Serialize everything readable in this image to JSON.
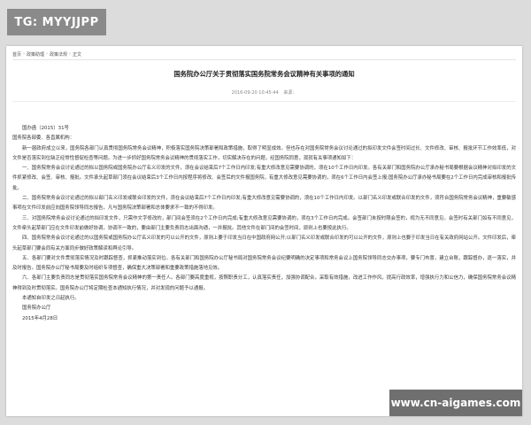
{
  "watermarks": {
    "top": "TG: MYYJJPP",
    "bottom": "www.cn-aigames.com"
  },
  "breadcrumb": {
    "items": [
      "首页",
      "政策助理",
      "政策法规",
      "正文"
    ],
    "separator": "›"
  },
  "article": {
    "title": "国务院办公厅关于贯彻落实国务院常务会议精神有关事项的通知",
    "date": "2016-09-20 10:45:44",
    "source": "来源："
  },
  "doc": {
    "number": "国办函〔2015〕31号",
    "salutation": "国务院各部委、各直属机构：",
    "paragraphs": [
      "新一届政府成立以来，国务院各部门认真贯彻国务院常务会议精神，积极落实国务院决策部署和政策措施，取得了明显成效。但也存在对国务院常务会议讨论通过的拟印发文件会签时间过长、文件修改、审核、报批环节工作效率低，对文件是否落实到位缺乏经常性督促检查等问题。为进一步抓好国务院常务会议精神的贯彻落实工作，切实解决存在的问题，经国务院同意，现就有关事项通知如下：",
      "一、国务院常务会议讨论通过的拟以国务院或国务院办公厅名义印发的文件，须在会议结束后7个工作日内印发;有重大修改意见需要协调的，须在10个工作日内印发。各有关部门和国务院办公厅承办秘书局要根据会议精神对拟印发的文件抓紧修改、会签、审核、报批。文件承头起草部门须在会议结束后3个工作日内按程序将修改、会签后的文件报国务院，有重大修改意见需要协调的，须在6个工作日内会签上报;国务院办公厅承办秘书局要在2个工作日内完成审核和报批传批。",
      "二、国务院常务会议讨论通过的拟以部门名义印发或联合印发的文件，须在会议结束后7个工作日内印发;有重大修改意见需要协调的，须在10个工作日内印发。以部门名义印发或联合印发的文件，须符合国务院常务会议精神，重要敏感事项在文件印发前应向国务院领导同志报告，凡与国务院决策部署和总体要求不一致的不得印发。",
      "三、对国务院常务会议讨论通过的拟印发文件，只需作文字修改的，部门间会签须在2个工作日内完成;有重大修改意见需要协调的，须在3个工作日内完成。会签部门未按时限会签的，视为无不同意见。会签时有关部门如有不同意见，文件牵头起草部门应在文件印发前做好协调，协调不一致的，要由部门主要负责同志出面沟通，一并报批。其他文件在部门间的会签时间，原则上也要按此执行。",
      "四、国务院常务会议讨论通过的以国务院或国务院办公厅名义印发的可以公开的文件，原则上要于印发当日在中国政府网公开;以部门名义印发或联合印发的可以公开的文件，原则上也要于印发当日在有关政府网站公开。文件印发后，牵头起草部门要会同有关方面同步做好政策解读和舆论引导。",
      "五、各部门要对文件贯彻落实情况及时跟踪督查，抓紧推动落实到位。各有关部门和国务院办公厅秘书局对国务院常务会议纪要明确的决定事项和常务会议上国务院领导同志交办事项，要专门布置，建立台账，跟踪督办，逐一落实，并及时报告。国务院办公厅秘书局要及时组织专项督查，确保重大决策部署和重要政策措施落地见效。",
      "六、各部门主要负责同志是贯彻落实国务院常务会议精神的第一责任人。各部门要高度重视，按照职责分工，认真落实责任，加强协调配合，采取有效措施，改进工作作风，提高行政效率，增强执行力和公信力，确保国务院常务会议精神得到及时贯彻落实。国务院办公厅将定期检查本通知执行情况，并对发现的问题予以通报。",
      "本通知自印发之日起执行。"
    ],
    "sign_org": "国务院办公厅",
    "sign_date": "2015年4月28日"
  }
}
